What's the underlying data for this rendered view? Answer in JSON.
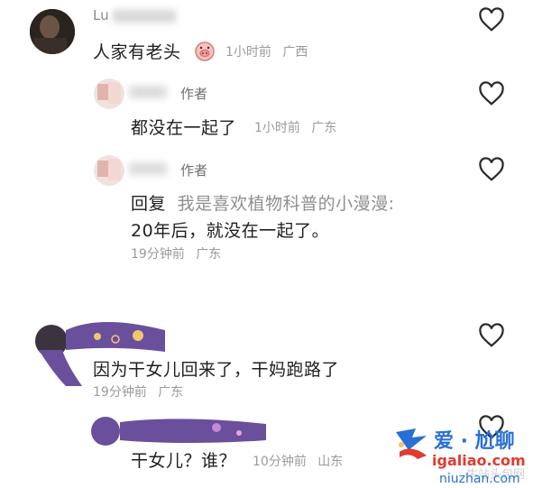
{
  "comments": [
    {
      "username": "Lu",
      "content": "人家有老头",
      "emoji": "pig-face-icon",
      "time": "1小时前",
      "location": "广西"
    },
    {
      "role": "作者",
      "content": "都没在一起了",
      "time": "1小时前",
      "location": "广东"
    },
    {
      "role": "作者",
      "reply_label": "回复",
      "reply_to": "我是喜欢植物科普的小漫漫:",
      "content": "20年后，就没在一起了。",
      "time": "19分钟前",
      "location": "广东"
    },
    {
      "content": "因为干女儿回来了，干妈跑路了",
      "time": "19分钟前",
      "location": "广东"
    },
    {
      "content": "干女儿？谁？",
      "time": "10分钟前",
      "location": "山东"
    }
  ],
  "watermark": {
    "brand": "爱 · 尬聊",
    "url": "igaliao.com",
    "domain2": "niuzhan.com",
    "faint_text": "牛站头包网"
  },
  "colors": {
    "brand_blue": "#2a6fd6",
    "brand_red": "#e23a2f",
    "avatar_purple": "#6a4f9c"
  }
}
